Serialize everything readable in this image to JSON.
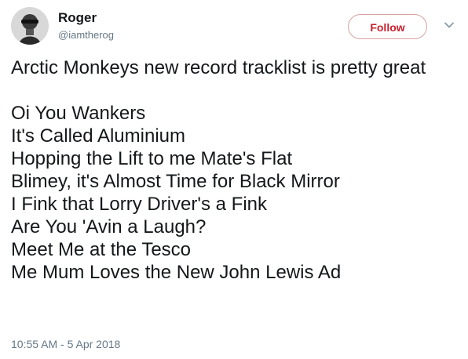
{
  "author": {
    "display_name": "Roger",
    "handle": "@iamtherog"
  },
  "header": {
    "follow_label": "Follow",
    "follow_color": "#c8202d",
    "menu_icon": "chevron-down-icon"
  },
  "tweet": {
    "intro": "Arctic Monkeys new record tracklist is pretty great",
    "tracks": [
      "Oi You Wankers",
      "It's Called Aluminium",
      "Hopping the Lift to me Mate's Flat",
      "Blimey, it's Almost Time for Black Mirror",
      "I Fink that Lorry Driver's a Fink",
      "Are You 'Avin a Laugh?",
      "Meet Me at the Tesco",
      "Me Mum Loves the New John Lewis Ad"
    ],
    "timestamp": "10:55 AM - 5 Apr 2018"
  }
}
